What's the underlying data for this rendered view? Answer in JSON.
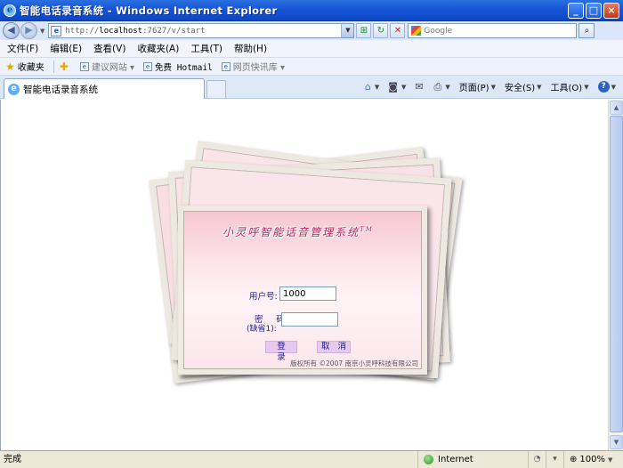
{
  "window": {
    "title": "智能电话录音系统 - Windows Internet Explorer",
    "minimize": "_",
    "maximize": "□",
    "close": "×"
  },
  "address_bar": {
    "url_prefix": "http://",
    "url_host": "localhost",
    "url_rest": ":7627/v/start",
    "search_placeholder": "Google"
  },
  "menu": {
    "items": [
      "文件(F)",
      "编辑(E)",
      "查看(V)",
      "收藏夹(A)",
      "工具(T)",
      "帮助(H)"
    ]
  },
  "favorites_bar": {
    "favorites": "收藏夹",
    "suggested": "建议网站 ▾",
    "hotmail": "免费 Hotmail",
    "webslice": "网页快讯库 ▾"
  },
  "tab": {
    "title": "智能电话录音系统"
  },
  "command_bar": {
    "page": "页面(P)",
    "safety": "安全(S)",
    "tools": "工具(O)"
  },
  "login": {
    "system_title": "小灵呼智能话音管理系统",
    "trademark": "TM",
    "user_label": "用户号:",
    "user_value": "1000",
    "password_label": "密 码",
    "password_hint": "(缺省1):",
    "password_value": "",
    "login_button": "登 录",
    "cancel_button": "取 消",
    "copyright": "版权所有 ©2007 南京小灵呼科技有限公司"
  },
  "status_bar": {
    "status": "完成",
    "zone": "Internet",
    "zoom": "100%"
  },
  "icons": {
    "back": "arrow-left-icon",
    "forward": "arrow-right-icon",
    "refresh": "refresh-icon",
    "stop": "stop-icon",
    "search": "magnifier-icon",
    "home": "home-icon",
    "feeds": "rss-icon",
    "mail": "mail-icon",
    "print": "printer-icon",
    "help": "help-icon"
  },
  "colors": {
    "title_bar": "#1655d6",
    "card_pink": "#f7c7d1",
    "label_blue": "#1c1c8a",
    "button_purple": "#e6c9ee",
    "title_magenta": "#c2185b"
  }
}
